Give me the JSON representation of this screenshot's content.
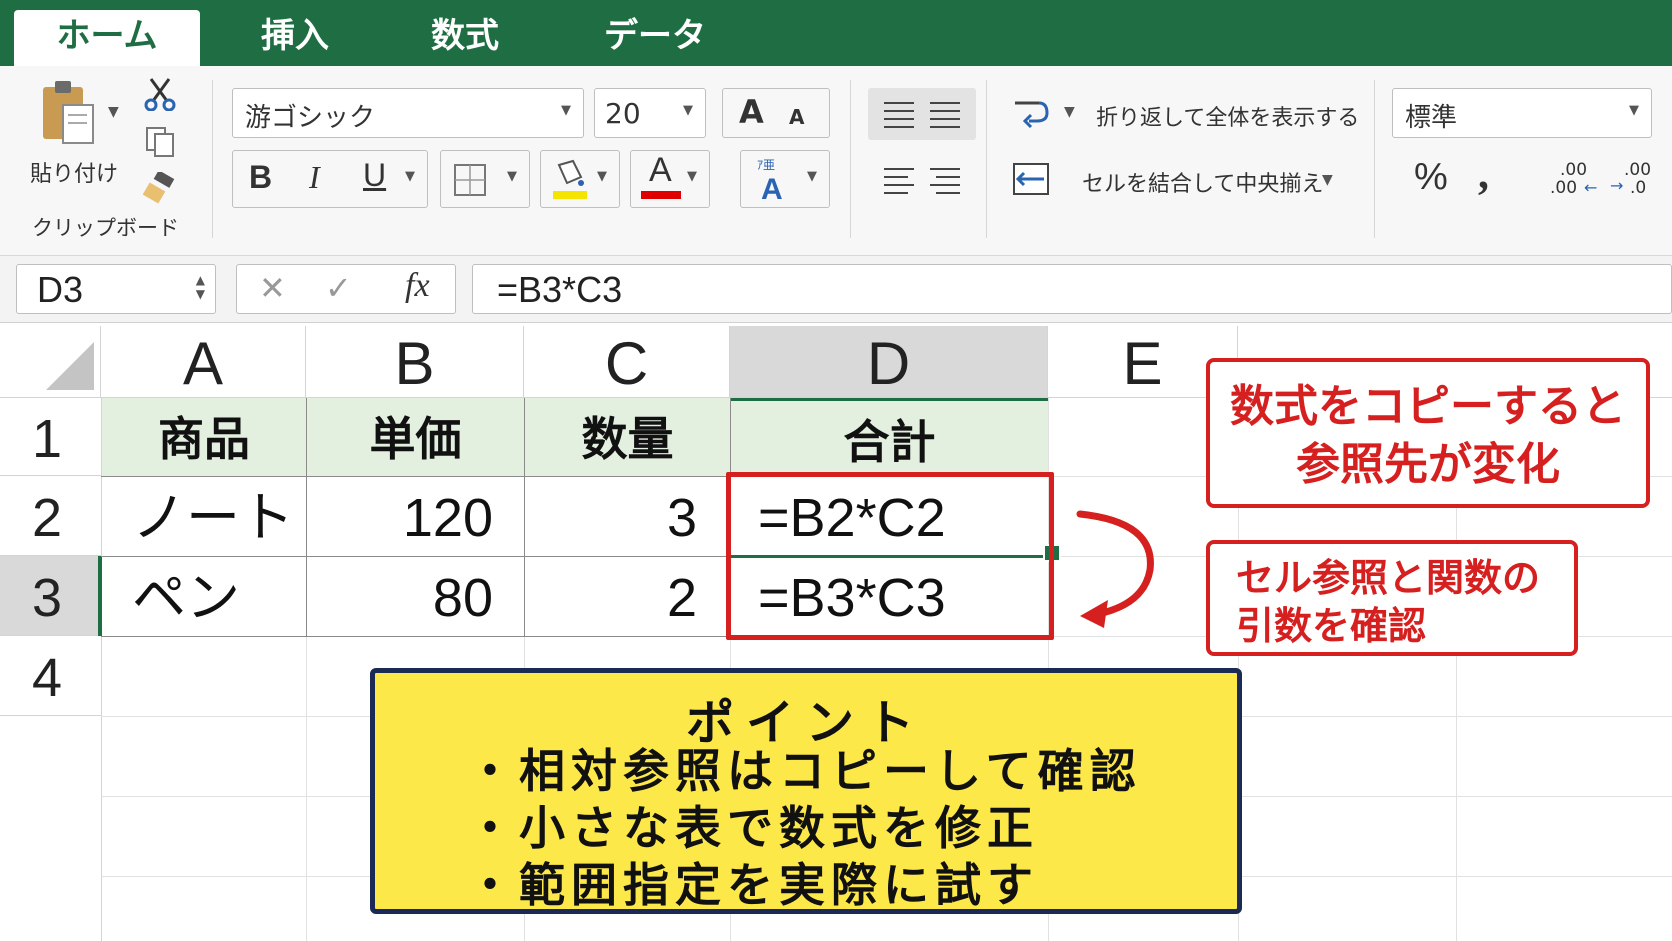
{
  "tabs": [
    "ホーム",
    "挿入",
    "数式",
    "データ"
  ],
  "clipboard": {
    "paste_label": "貼り付け",
    "group_label": "クリップボード"
  },
  "font": {
    "name": "游ゴシック",
    "size": "20",
    "bold": "B",
    "italic": "I",
    "underline": "U",
    "grow": "A",
    "shrink": "A",
    "color_letter": "A",
    "highlight_color": "#f5e300",
    "font_color": "#e00000"
  },
  "alignment": {
    "wrap_text": "折り返して全体を表示する",
    "merge_center": "セルを結合して中央揃え"
  },
  "number": {
    "format": "標準",
    "percent": "%",
    "comma": ",",
    "inc_decimal_top": ".00",
    "inc_decimal_bottom": ".00",
    "dec_decimal_top": ".00",
    "dec_decimal_bottom": ".0"
  },
  "formula_bar": {
    "name_box": "D3",
    "cancel": "✕",
    "enter": "✓",
    "fx": "fx",
    "formula": "=B3*C3"
  },
  "columns": [
    "A",
    "B",
    "C",
    "D",
    "E"
  ],
  "rows": [
    "1",
    "2",
    "3",
    "4"
  ],
  "table": {
    "headers": [
      "商品",
      "単価",
      "数量",
      "合計"
    ],
    "rows": [
      [
        "ノート",
        "120",
        "3",
        "=B2*C2"
      ],
      [
        "ペン",
        "80",
        "2",
        "=B3*C3"
      ]
    ]
  },
  "callouts": {
    "copy_line1": "数式をコピーすると",
    "copy_line2": "参照先が変化",
    "ref_line1": "セル参照と関数の",
    "ref_line2": "引数を確認"
  },
  "point_box": {
    "title": "ポイント",
    "items": [
      "相対参照はコピーして確認",
      "小さな表で数式を修正",
      "範囲指定を実際に試す"
    ]
  },
  "colors": {
    "excel_green": "#1f6e43",
    "header_fill": "#e3f0e0",
    "callout_red": "#d61f1f",
    "point_fill": "#fde84a",
    "point_border": "#1a2a55"
  }
}
